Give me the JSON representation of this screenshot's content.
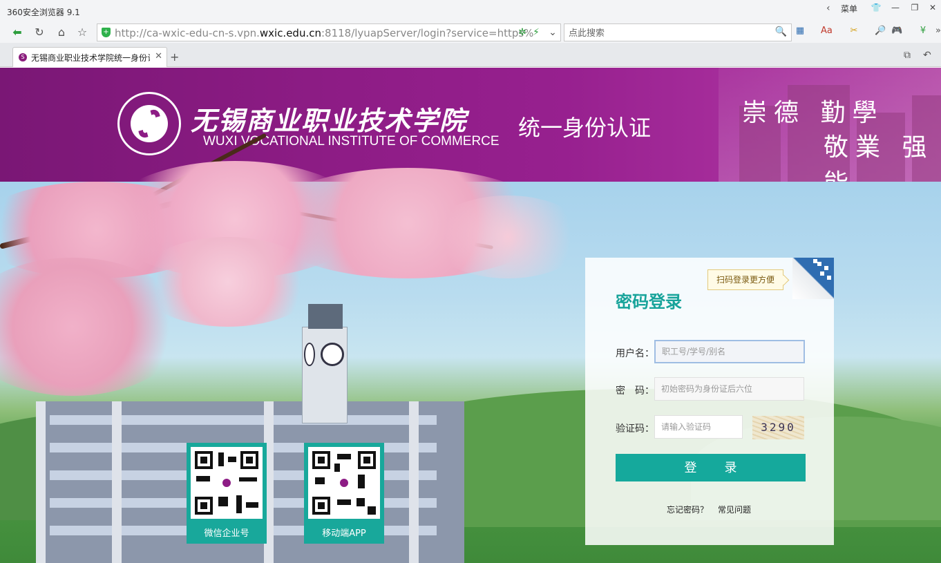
{
  "browser": {
    "app_title": "360安全浏览器 9.1",
    "menu_label": "菜单",
    "url_prefix": "http://ca-wxic-edu-cn-s.vpn.",
    "url_domain": "wxic.edu.cn",
    "url_suffix": ":8118/lyuapServer/login?service=https%",
    "search_placeholder": "点此搜索",
    "tab_title": "无锡商业职业技术学院统一身份认"
  },
  "banner": {
    "school_name_cn": "无锡商业职业技术学院",
    "school_name_en": "WUXI VOCATIONAL INSTITUTE OF COMMERCE",
    "system_title": "统一身份认证",
    "motto_line1": "崇德 勤學",
    "motto_line2": "敬業 强能",
    "brand_color": "#8d1c85"
  },
  "login": {
    "qr_tip": "扫码登录更方便",
    "title": "密码登录",
    "username_label": "用户名：",
    "username_placeholder": "职工号/学号/别名",
    "password_label": "密　码：",
    "password_placeholder": "初始密码为身份证后六位",
    "captcha_label": "验证码：",
    "captcha_placeholder": "请输入验证码",
    "captcha_text": "3290",
    "submit_label": "登录",
    "forgot_label": "忘记密码？",
    "faq_label": "常见问题",
    "accent_color": "#15a99c"
  },
  "qr_cards": [
    {
      "caption": "微信企业号"
    },
    {
      "caption": "移动端APP"
    }
  ]
}
